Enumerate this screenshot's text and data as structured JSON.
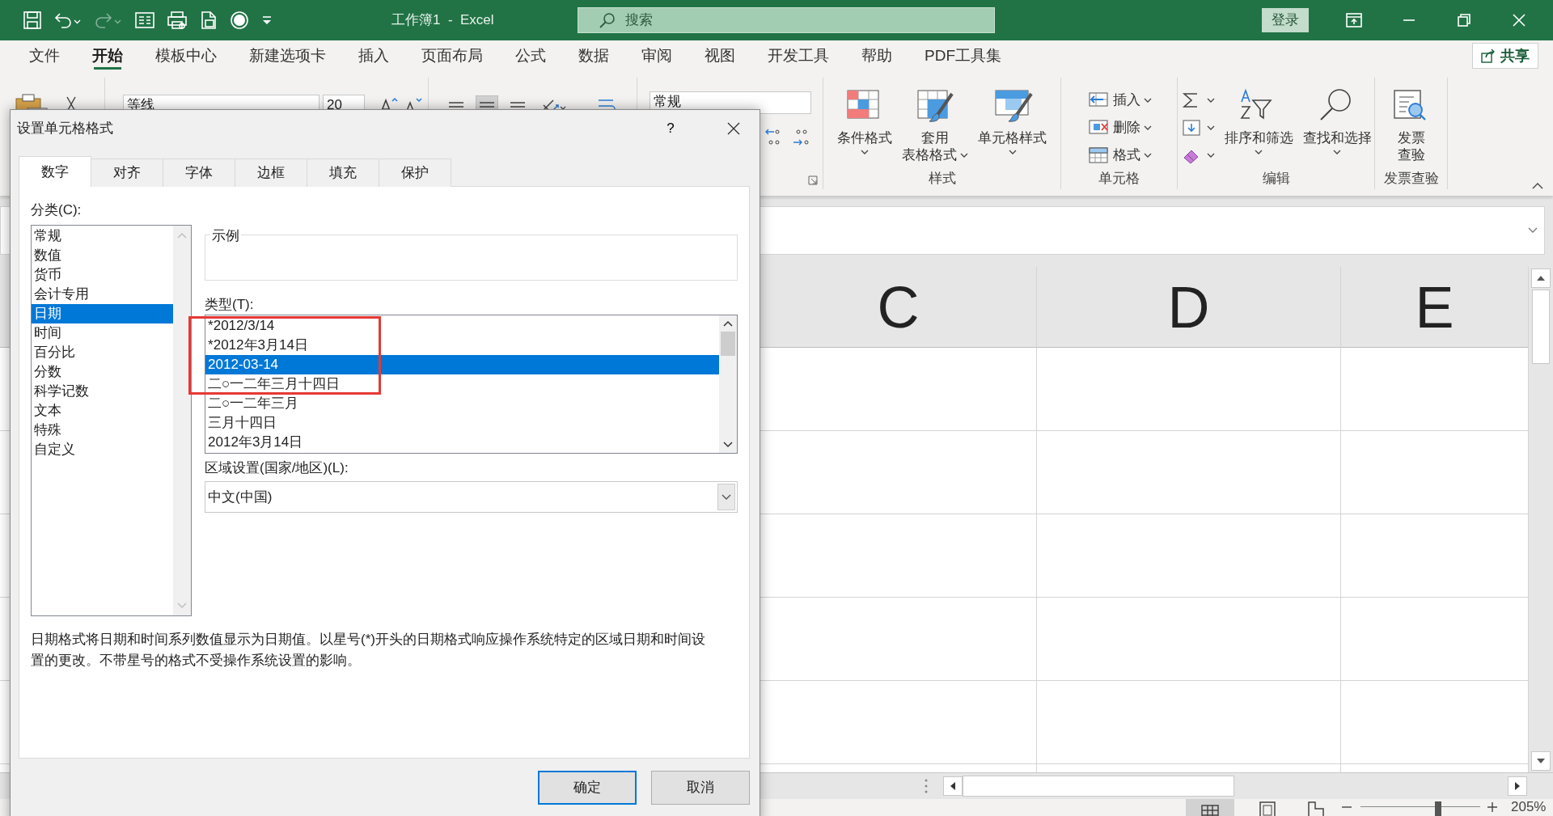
{
  "title_bar": {
    "title": "工作簿1  -  Excel",
    "search": {
      "placeholder": "搜索"
    },
    "sign_in": "登录"
  },
  "ribbon_tabs": [
    {
      "label": "文件",
      "selected": false
    },
    {
      "label": "开始",
      "selected": true
    },
    {
      "label": "模板中心",
      "selected": false
    },
    {
      "label": "新建选项卡",
      "selected": false
    },
    {
      "label": "插入",
      "selected": false
    },
    {
      "label": "页面布局",
      "selected": false
    },
    {
      "label": "公式",
      "selected": false
    },
    {
      "label": "数据",
      "selected": false
    },
    {
      "label": "审阅",
      "selected": false
    },
    {
      "label": "视图",
      "selected": false
    },
    {
      "label": "开发工具",
      "selected": false
    },
    {
      "label": "帮助",
      "selected": false
    },
    {
      "label": "PDF工具集",
      "selected": false
    }
  ],
  "share_button": "共享",
  "ribbon": {
    "font_name": "等线",
    "font_size": "20",
    "number_format": "常规",
    "groups": [
      {
        "label": "样式",
        "commands": [
          {
            "kind": "large",
            "lines": [
              "条件格式"
            ],
            "menu": true
          },
          {
            "kind": "large",
            "lines": [
              "套用",
              "表格格式"
            ],
            "menu": true
          },
          {
            "kind": "large",
            "lines": [
              "单元格样式"
            ],
            "menu": true
          }
        ]
      },
      {
        "label": "单元格",
        "commands": [
          {
            "kind": "small",
            "label": "插入",
            "menu": true
          },
          {
            "kind": "small",
            "label": "删除",
            "menu": true
          },
          {
            "kind": "small",
            "label": "格式",
            "menu": true
          }
        ]
      },
      {
        "label": "编辑",
        "commands": [
          {
            "kind": "small",
            "menu": true
          },
          {
            "kind": "small",
            "menu": true
          },
          {
            "kind": "small",
            "menu": true
          },
          {
            "kind": "large",
            "lines": [
              "排序和筛选"
            ],
            "menu": true
          },
          {
            "kind": "large",
            "lines": [
              "查找和选择"
            ],
            "menu": true
          }
        ]
      },
      {
        "label": "发票查验",
        "commands": [
          {
            "kind": "large",
            "lines": [
              "发票",
              "查验"
            ],
            "menu": false
          }
        ]
      }
    ]
  },
  "sheet": {
    "columns": [
      "C",
      "D",
      "E"
    ]
  },
  "status_bar": {
    "zoom": "205%",
    "zoom_slider": {
      "level": 0.66
    }
  },
  "dialog": {
    "title": "设置单元格格式",
    "help_button": "?",
    "tabs": [
      {
        "label": "数字",
        "selected": true
      },
      {
        "label": "对齐",
        "selected": false
      },
      {
        "label": "字体",
        "selected": false
      },
      {
        "label": "边框",
        "selected": false
      },
      {
        "label": "填充",
        "selected": false
      },
      {
        "label": "保护",
        "selected": false
      }
    ],
    "category_label": "分类(C):",
    "categories": [
      {
        "label": "常规",
        "selected": false
      },
      {
        "label": "数值",
        "selected": false
      },
      {
        "label": "货币",
        "selected": false
      },
      {
        "label": "会计专用",
        "selected": false
      },
      {
        "label": "日期",
        "selected": true
      },
      {
        "label": "时间",
        "selected": false
      },
      {
        "label": "百分比",
        "selected": false
      },
      {
        "label": "分数",
        "selected": false
      },
      {
        "label": "科学记数",
        "selected": false
      },
      {
        "label": "文本",
        "selected": false
      },
      {
        "label": "特殊",
        "selected": false
      },
      {
        "label": "自定义",
        "selected": false
      }
    ],
    "sample_label": "示例",
    "type_label": "类型(T):",
    "types": [
      {
        "label": "*2012/3/14",
        "selected": false
      },
      {
        "label": "*2012年3月14日",
        "selected": false
      },
      {
        "label": "2012-03-14",
        "selected": true
      },
      {
        "label": "二○一二年三月十四日",
        "selected": false
      },
      {
        "label": "二○一二年三月",
        "selected": false
      },
      {
        "label": "三月十四日",
        "selected": false
      },
      {
        "label": "2012年3月14日",
        "selected": false
      }
    ],
    "annotations": [
      {
        "kind": "box"
      }
    ],
    "locale_label": "区域设置(国家/地区)(L):",
    "locale": "中文(中国)",
    "description": "日期格式将日期和时间系列数值显示为日期值。以星号(*)开头的日期格式响应操作系统特定的区域日期和时间设置的更改。不带星号的格式不受操作系统设置的影响。",
    "buttons": [
      {
        "label": "确定",
        "default": true
      },
      {
        "label": "取消",
        "default": false
      }
    ]
  }
}
